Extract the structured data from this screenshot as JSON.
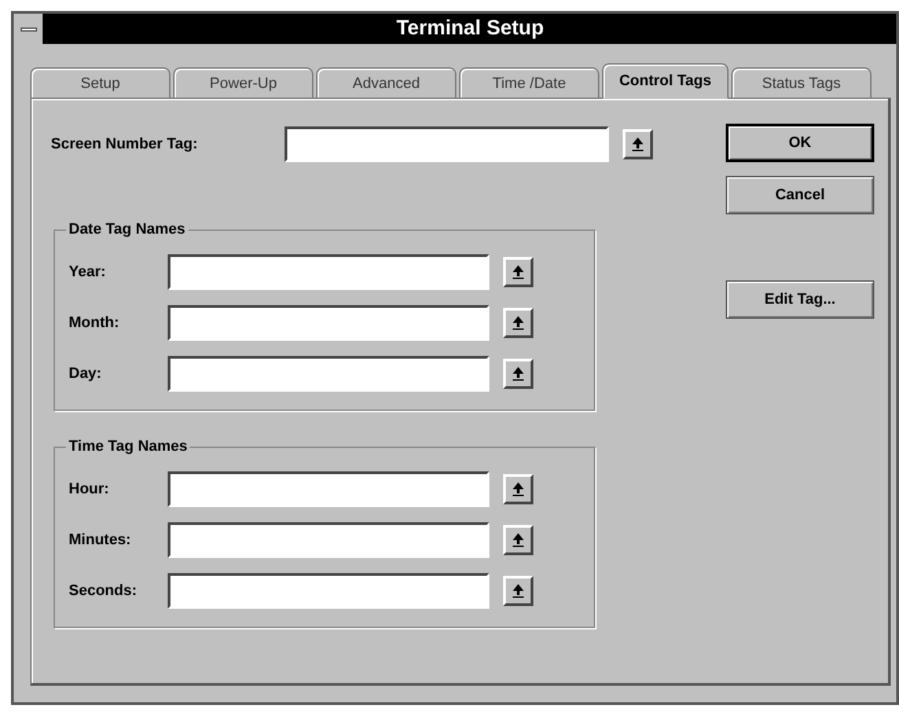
{
  "window": {
    "title": "Terminal Setup"
  },
  "tabs": [
    {
      "label": "Setup",
      "selected": false
    },
    {
      "label": "Power-Up",
      "selected": false
    },
    {
      "label": "Advanced",
      "selected": false
    },
    {
      "label": "Time /Date",
      "selected": false
    },
    {
      "label": "Control Tags",
      "selected": true
    },
    {
      "label": "Status Tags",
      "selected": false
    }
  ],
  "screen_number_tag": {
    "label": "Screen Number Tag:"
  },
  "groups": [
    {
      "title": "Date Tag Names",
      "fields": [
        {
          "label": "Year:"
        },
        {
          "label": "Month:"
        },
        {
          "label": "Day:"
        }
      ]
    },
    {
      "title": "Time Tag Names",
      "fields": [
        {
          "label": "Hour:"
        },
        {
          "label": "Minutes:"
        },
        {
          "label": "Seconds:"
        }
      ]
    }
  ],
  "buttons": [
    {
      "label": "OK",
      "kind": "default"
    },
    {
      "label": "Cancel",
      "kind": "normal"
    },
    {
      "label": "Edit Tag...",
      "kind": "spaced"
    }
  ]
}
